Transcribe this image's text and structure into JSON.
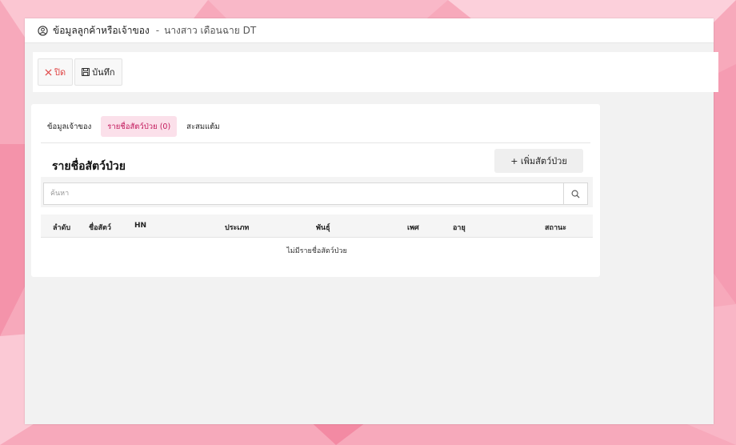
{
  "window": {
    "title": "ข้อมูลลูกค้าหรือเจ้าของ",
    "separator": "-",
    "owner_name": "นางสาว เดือนฉาย DT"
  },
  "toolbar": {
    "close_label": "ปิด",
    "save_label": "บันทึก"
  },
  "tabs": [
    {
      "label": "ข้อมูลเจ้าของ",
      "active": false
    },
    {
      "label": "รายชื่อสัตว์ป่วย (0)",
      "active": true
    },
    {
      "label": "สะสมแต้ม",
      "active": false
    }
  ],
  "section": {
    "title": "รายชื่อสัตว์ป่วย",
    "add_button": "+ เพิ่มสัตว์ป่วย"
  },
  "search": {
    "placeholder": "ค้นหา",
    "value": ""
  },
  "table": {
    "columns": [
      "ลำดับ",
      "ชื่อสัตว์",
      "HN",
      "ประเภท",
      "พันธุ์",
      "เพศ",
      "อายุ",
      "สถานะ"
    ],
    "rows": [],
    "empty_message": "ไม่มีรายชื่อสัตว์ป่วย"
  },
  "colors": {
    "accent": "#c2185b",
    "active_tab_bg": "#fbe0ea",
    "close_red": "#e04848",
    "background_pink": "#f5a3b5"
  },
  "icons": {
    "title": "user-circle-icon",
    "close": "close-x-icon",
    "save": "floppy-disk-icon",
    "search": "search-icon"
  }
}
